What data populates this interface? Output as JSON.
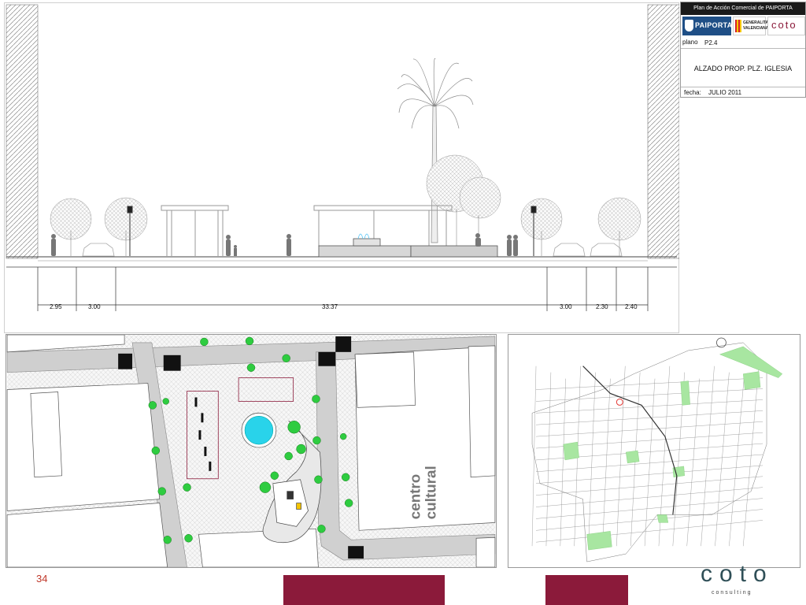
{
  "title_block": {
    "header": "Plan de Acción Comercial de PAIPORTA",
    "logos": {
      "paiporta": "PAIPORTA",
      "generalitat": "GENERALITAT VALENCIANA",
      "coto": "coto"
    },
    "plano_label": "plano",
    "plano_value": "P2.4",
    "drawing_title": "ALZADO PROP. PLZ. IGLESIA",
    "fecha_label": "fecha:",
    "fecha_value": "JULIO 2011"
  },
  "elevation": {
    "dimensions": [
      "2.95",
      "3.00",
      "33.37",
      "3.00",
      "2.30",
      "2.40"
    ]
  },
  "plan": {
    "label_line1": "centro",
    "label_line2": "cultural"
  },
  "footer": {
    "page_number": "34",
    "brand": "coto",
    "brand_sub": "consulting"
  },
  "colors": {
    "brand_maroon": "#8b1a3a",
    "fountain_cyan": "#29d3ea",
    "tree_green": "#2ecc40",
    "paiporta_blue": "#1f4f86"
  }
}
